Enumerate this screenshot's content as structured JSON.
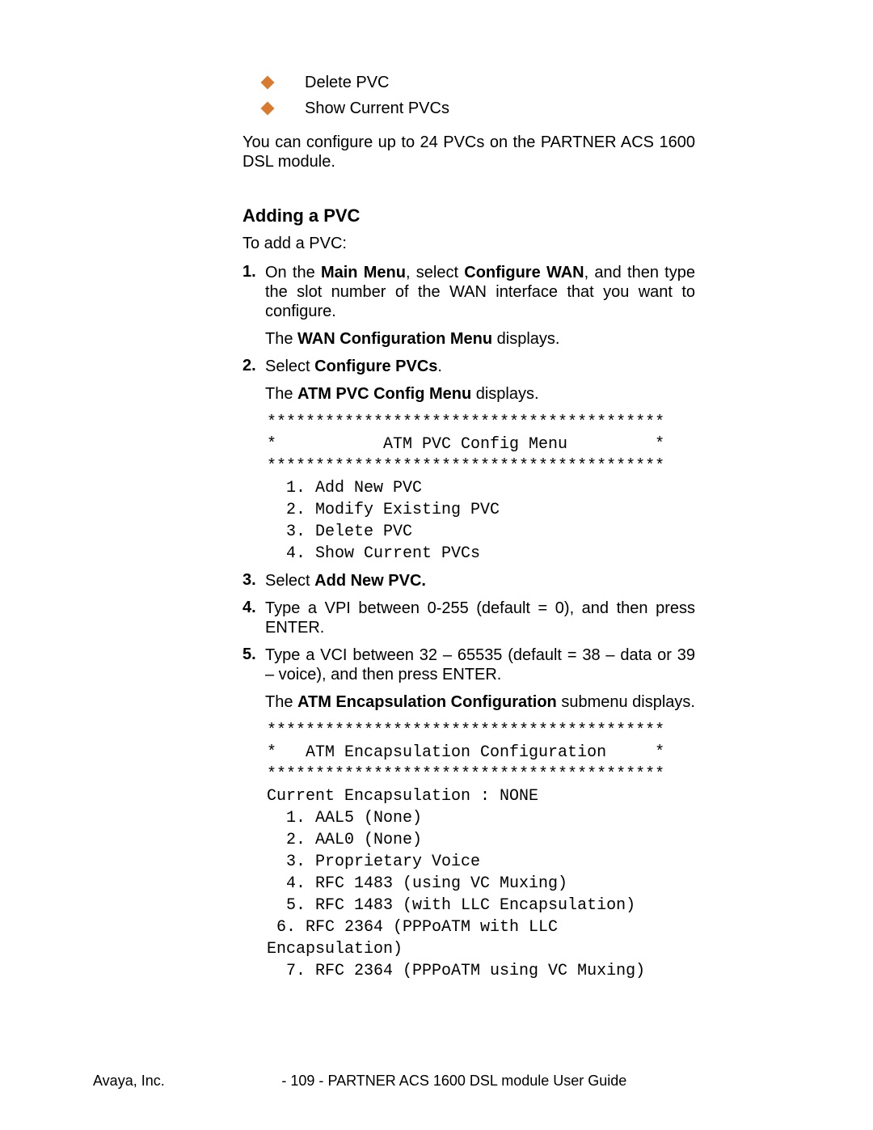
{
  "bullets": {
    "b1": "Delete PVC",
    "b2": "Show Current PVCs"
  },
  "intro": "You can configure up to 24 PVCs on the PARTNER ACS 1600 DSL module.",
  "heading": "Adding a PVC",
  "toAdd": "To add a PVC:",
  "steps": {
    "s1": {
      "num": "1.",
      "p1a": "On the ",
      "p1b": "Main Menu",
      "p1c": ", select ",
      "p1d": "Configure WAN",
      "p1e": ", and then type the slot number of the WAN interface that you want to configure.",
      "p2a": "The ",
      "p2b": "WAN Configuration Menu",
      "p2c": " displays."
    },
    "s2": {
      "num": "2.",
      "p1a": "Select ",
      "p1b": "Configure PVCs",
      "p1c": ".",
      "p2a": "The ",
      "p2b": "ATM PVC Config Menu",
      "p2c": " displays."
    },
    "menu1": "*****************************************\n*           ATM PVC Config Menu         *\n*****************************************\n  1. Add New PVC\n  2. Modify Existing PVC\n  3. Delete PVC\n  4. Show Current PVCs",
    "s3": {
      "num": "3.",
      "p1a": "Select ",
      "p1b": "Add New PVC."
    },
    "s4": {
      "num": "4.",
      "p1": "Type a VPI between 0-255 (default = 0), and then press ENTER."
    },
    "s5": {
      "num": "5.",
      "p1": "Type a VCI between 32 – 65535 (default = 38 – data or 39 – voice), and then press ENTER.",
      "p2a": "The ",
      "p2b": "ATM Encapsulation Configuration",
      "p2c": " submenu displays."
    },
    "menu2": "*****************************************\n*   ATM Encapsulation Configuration     *\n*****************************************\nCurrent Encapsulation : NONE\n  1. AAL5 (None)\n  2. AAL0 (None)\n  3. Proprietary Voice\n  4. RFC 1483 (using VC Muxing)\n  5. RFC 1483 (with LLC Encapsulation)\n 6. RFC 2364 (PPPoATM with LLC\nEncapsulation)\n  7. RFC 2364 (PPPoATM using VC Muxing)"
  },
  "footer": {
    "left": "Avaya, Inc.",
    "page": "- 109 -",
    "right": "PARTNER ACS 1600 DSL module User Guide"
  }
}
